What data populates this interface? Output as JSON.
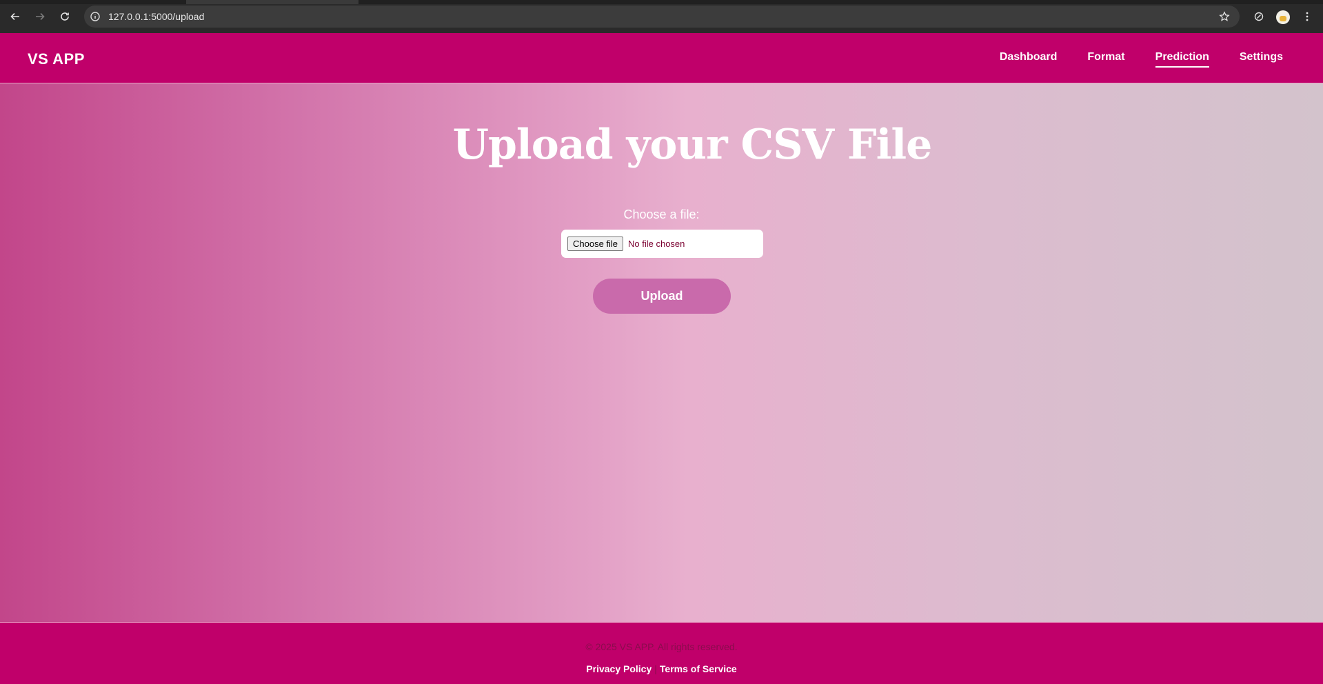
{
  "browser": {
    "url": "127.0.0.1:5000/upload"
  },
  "header": {
    "brand": "VS APP",
    "nav": [
      {
        "label": "Dashboard"
      },
      {
        "label": "Format"
      },
      {
        "label": "Prediction",
        "active": true
      },
      {
        "label": "Settings"
      }
    ]
  },
  "main": {
    "title": "Upload your CSV File",
    "file_label": "Choose a file:",
    "file_button": "Choose file",
    "file_status": "No file chosen",
    "upload_button": "Upload"
  },
  "footer": {
    "copyright": "© 2025 VS APP. All rights reserved.",
    "privacy": "Privacy Policy",
    "separator": "|",
    "terms": "Terms of Service"
  },
  "colors": {
    "primary": "#c0006a",
    "button": "#c96aab"
  }
}
